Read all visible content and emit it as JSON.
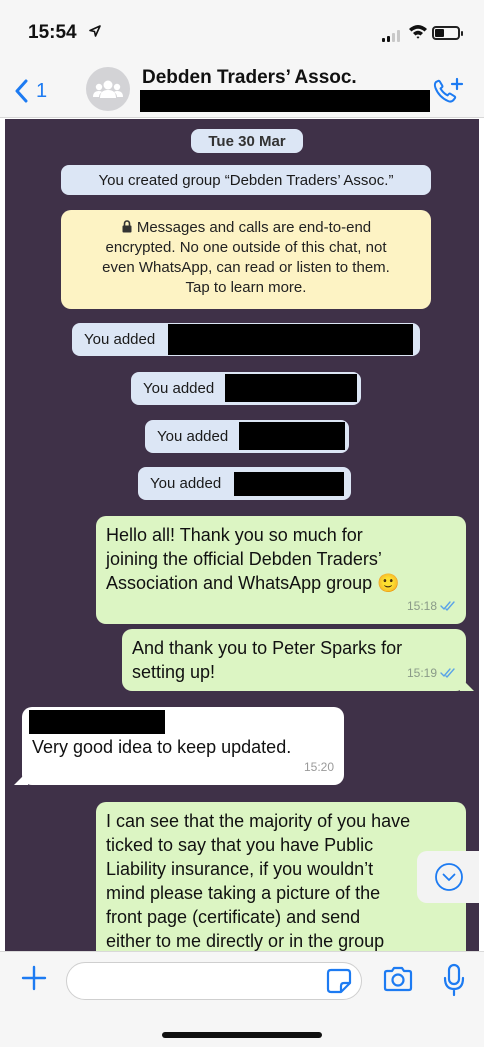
{
  "status_bar": {
    "time": "15:54"
  },
  "header": {
    "back_count": "1",
    "group_name": "Debden Traders’ Assoc."
  },
  "system": {
    "date": "Tue 30 Mar",
    "created": "You created group “Debden Traders’ Assoc.”",
    "encryption": [
      "Messages and calls are end-to-end",
      "encrypted. No one outside of this chat, not",
      "even WhatsApp, can read or listen to them.",
      "Tap to learn more."
    ],
    "added_label": "You added"
  },
  "messages": [
    {
      "direction": "out",
      "lines": [
        "Hello all! Thank you so much for",
        "joining the official Debden Traders’",
        "Association and WhatsApp group 🙂"
      ],
      "time": "15:18",
      "read": true
    },
    {
      "direction": "out",
      "lines": [
        "And thank you to Peter Sparks for",
        "setting up!"
      ],
      "time": "15:19",
      "read": true
    },
    {
      "direction": "in",
      "lines": [
        "Very good idea to keep updated."
      ],
      "time": "15:20"
    },
    {
      "direction": "out",
      "lines": [
        "I can see that the majority of you have",
        "ticked to say that you have Public",
        "Liability insurance, if you wouldn’t",
        "mind please taking a picture of the",
        "front page (certificate) and send",
        "either to me directly or in the group"
      ]
    }
  ],
  "colors": {
    "accent": "#1d7bf2",
    "chat_bg": "#3f3148",
    "outgoing": "#dcf5c3",
    "incoming": "#ffffff",
    "system": "#dce6f5",
    "encryption": "#fdf3c4"
  },
  "icons": [
    "location-arrow-icon",
    "signal-icon",
    "wifi-icon",
    "battery-icon",
    "back-chevron-icon",
    "group-avatar-icon",
    "add-call-icon",
    "lock-icon",
    "double-check-icon",
    "chevron-down-icon",
    "plus-icon",
    "sticker-icon",
    "camera-icon",
    "mic-icon"
  ]
}
